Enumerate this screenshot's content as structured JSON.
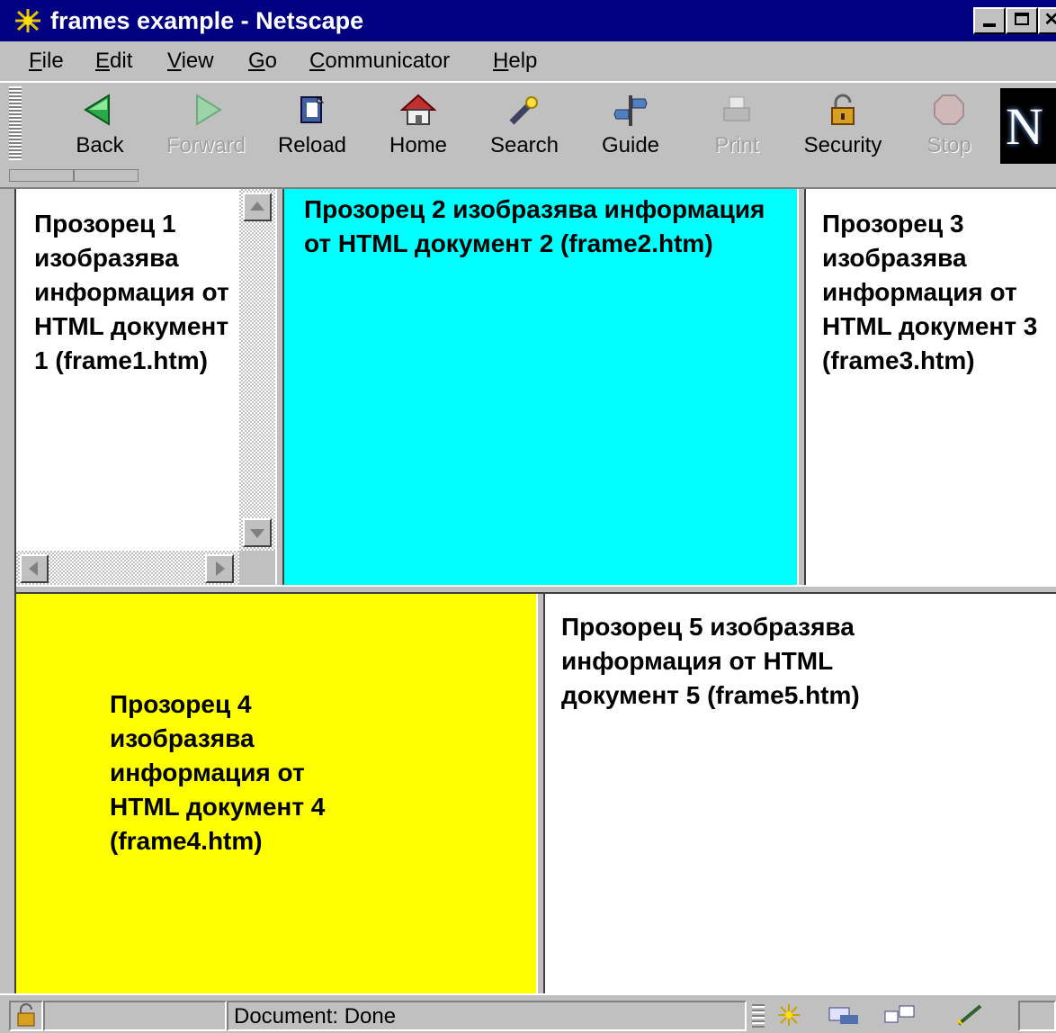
{
  "window": {
    "title": "frames example - Netscape",
    "controls": [
      "minimize",
      "maximize",
      "close"
    ]
  },
  "menu": [
    "File",
    "Edit",
    "View",
    "Go",
    "Communicator",
    "Help"
  ],
  "toolbar": {
    "buttons": [
      {
        "label": "Back",
        "icon": "back-arrow-icon",
        "enabled": true
      },
      {
        "label": "Forward",
        "icon": "forward-arrow-icon",
        "enabled": false
      },
      {
        "label": "Reload",
        "icon": "reload-icon",
        "enabled": true
      },
      {
        "label": "Home",
        "icon": "home-icon",
        "enabled": true
      },
      {
        "label": "Search",
        "icon": "search-icon",
        "enabled": true
      },
      {
        "label": "Guide",
        "icon": "guide-icon",
        "enabled": true
      },
      {
        "label": "Print",
        "icon": "print-icon",
        "enabled": false
      },
      {
        "label": "Security",
        "icon": "security-lock-icon",
        "enabled": true
      },
      {
        "label": "Stop",
        "icon": "stop-icon",
        "enabled": false
      }
    ],
    "logo": "N"
  },
  "frames": {
    "frame1": {
      "text": "Прозорец 1 изобразява информация от HTML документ 1 (frame1.htm)",
      "bg": "#ffffff"
    },
    "frame2": {
      "text": "Прозорец 2 изобразява информация от HTML документ 2 (frame2.htm)",
      "bg": "#00ffff"
    },
    "frame3": {
      "text": "Прозорец 3 изобразява информация от HTML документ 3 (frame3.htm)",
      "bg": "#ffffff"
    },
    "frame4": {
      "text": "Прозорец 4 изобразява информация от HTML документ 4 (frame4.htm)",
      "bg": "#ffff00"
    },
    "frame5": {
      "text": "Прозорец 5 изобразява информация от HTML документ 5 (frame5.htm)",
      "bg": "#ffffff"
    }
  },
  "status": {
    "text": "Document: Done",
    "icons": [
      "security-lock-icon",
      "netscape-navigator-icon",
      "mail-icon",
      "discussion-icon",
      "composer-icon"
    ]
  }
}
